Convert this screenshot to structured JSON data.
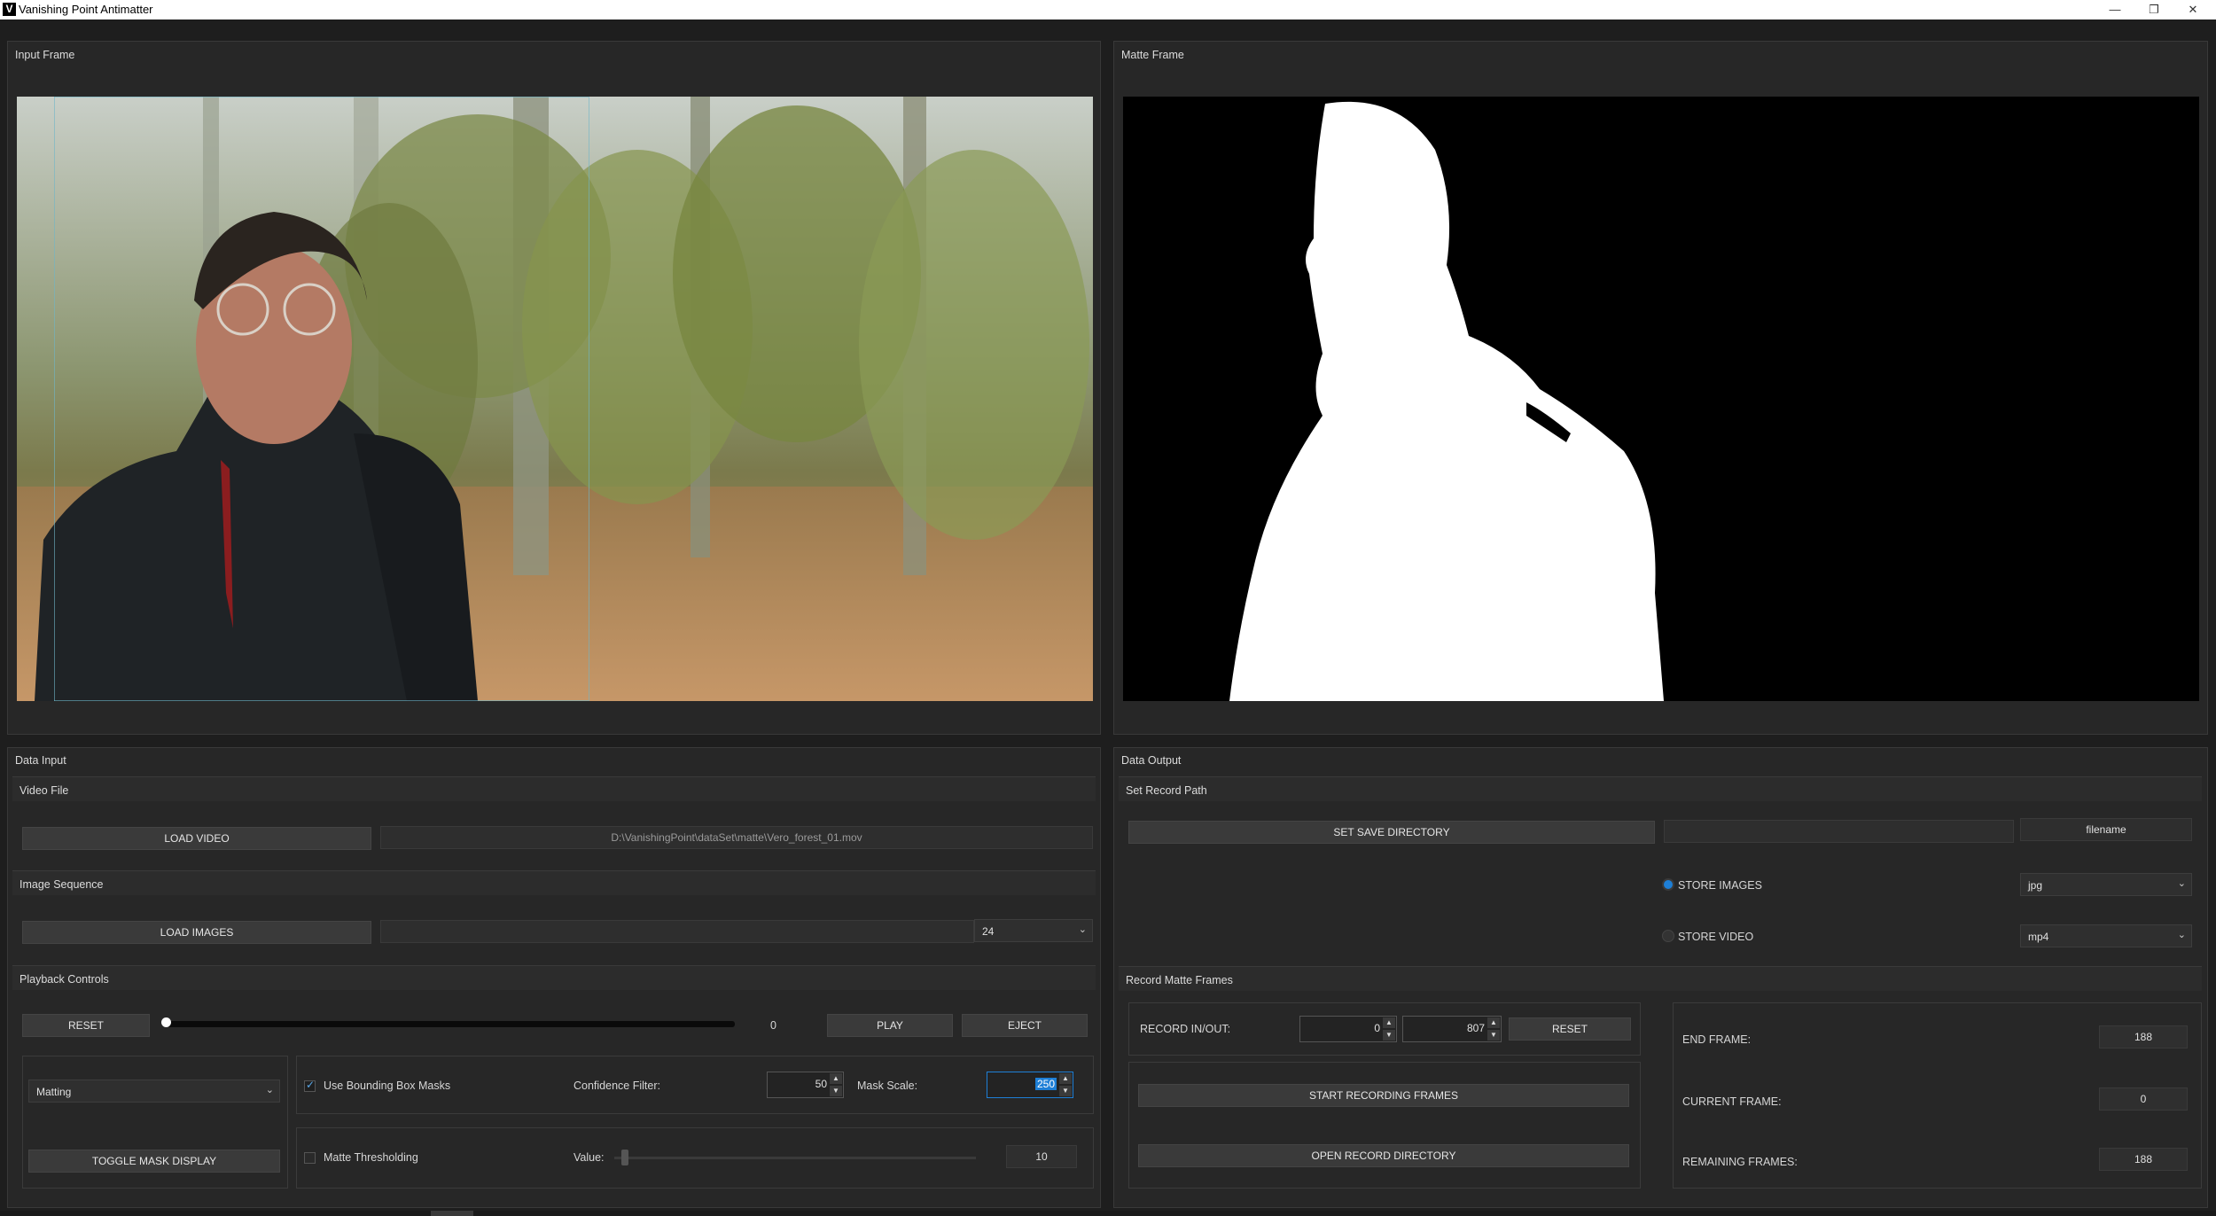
{
  "window": {
    "logo_letter": "V",
    "title": "Vanishing Point Antimatter",
    "minimize": "—",
    "restore": "❐",
    "close": "✕"
  },
  "input_frame": {
    "title": "Input Frame"
  },
  "matte_frame": {
    "title": "Matte Frame"
  },
  "data_input": {
    "title": "Data Input",
    "video_file": {
      "heading": "Video File",
      "load_button": "LOAD VIDEO",
      "path": "D:\\VanishingPoint\\dataSet\\matte\\Vero_forest_01.mov"
    },
    "image_sequence": {
      "heading": "Image Sequence",
      "load_button": "LOAD IMAGES",
      "path": "",
      "fps": "24"
    },
    "playback": {
      "heading": "Playback Controls",
      "reset": "RESET",
      "frame": "0",
      "play": "PLAY",
      "eject": "EJECT",
      "scrub_position": 0
    },
    "mode": {
      "selected": "Matting",
      "toggle_button": "TOGGLE MASK DISPLAY"
    },
    "bbox": {
      "label": "Use Bounding Box Masks",
      "checked": true,
      "confidence_label": "Confidence Filter:",
      "confidence": "50",
      "mask_scale_label": "Mask Scale:",
      "mask_scale": "250"
    },
    "threshold": {
      "label": "Matte Thresholding",
      "checked": false,
      "value_label": "Value:",
      "value": "10",
      "slider_fraction": 0.02
    }
  },
  "data_output": {
    "title": "Data Output",
    "record_path": {
      "heading": "Set Record Path",
      "set_dir_button": "SET SAVE DIRECTORY",
      "dir_value": "",
      "filename": "filename",
      "store_images": "STORE IMAGES",
      "store_images_selected": true,
      "image_format": "jpg",
      "store_video": "STORE VIDEO",
      "store_video_selected": false,
      "video_format": "mp4"
    },
    "record_frames": {
      "heading": "Record Matte Frames",
      "in_out_label": "RECORD IN/OUT:",
      "in": "0",
      "out": "807",
      "reset": "RESET",
      "start_button": "START RECORDING FRAMES",
      "open_button": "OPEN RECORD DIRECTORY",
      "end_frame_label": "END FRAME:",
      "end_frame": "188",
      "current_frame_label": "CURRENT FRAME:",
      "current_frame": "0",
      "remaining_label": "REMAINING FRAMES:",
      "remaining": "188"
    }
  },
  "colors": {
    "accent": "#1e7fd6",
    "panel": "#272727",
    "background": "#1e1e1e"
  },
  "icons": [
    "app-logo-icon",
    "minimize-icon",
    "restore-icon",
    "close-icon",
    "chevron-down-icon",
    "spin-up-icon",
    "spin-down-icon",
    "checkmark-icon"
  ]
}
